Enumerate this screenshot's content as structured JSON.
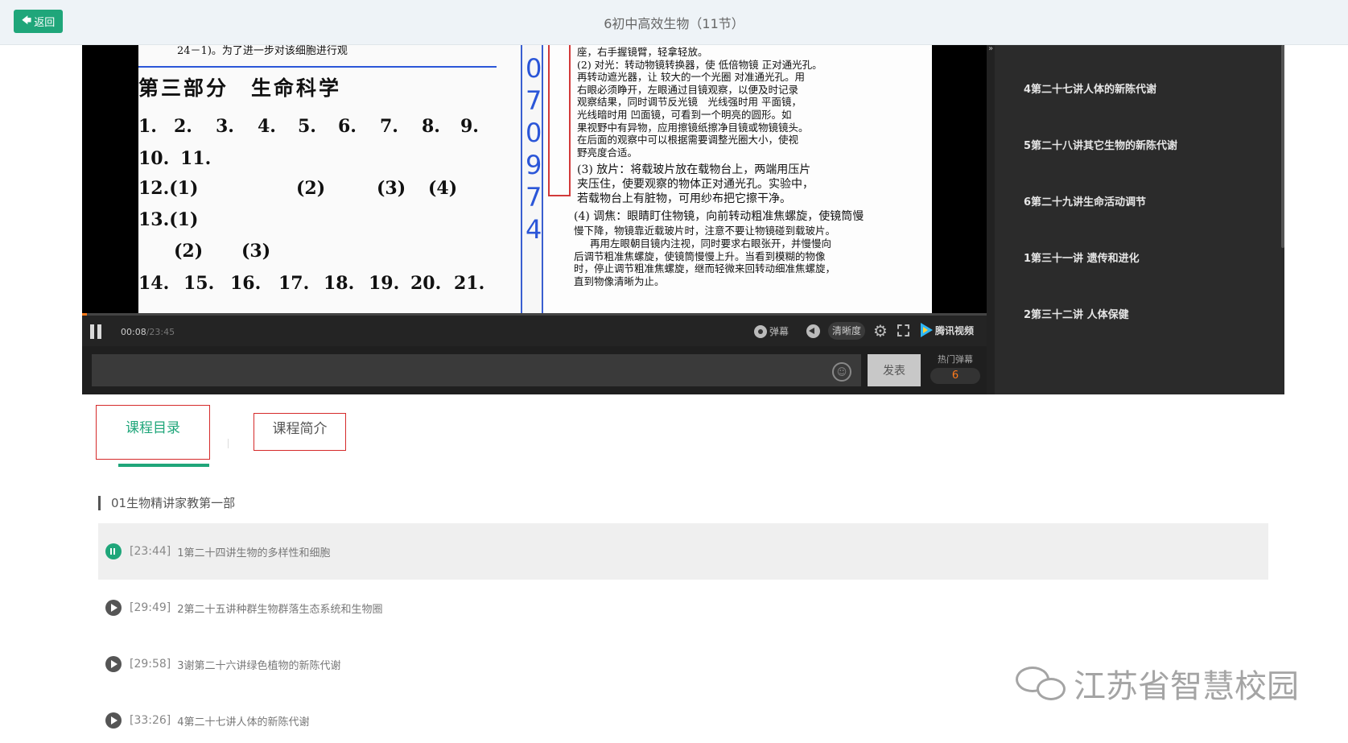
{
  "header": {
    "back_label": "返回",
    "title": "6初中高效生物（11节）"
  },
  "video": {
    "slide_left": {
      "top_line": "24－1)。为了进一步对该细胞进行观",
      "heading": "第三部分　生命科学",
      "rows": [
        [
          "1.",
          "2.",
          "3.",
          "4.",
          "5.",
          "6.",
          "7.",
          "8.",
          "9."
        ],
        [
          "10.",
          "11."
        ],
        [
          "12.(1)",
          "(2)",
          "(3)",
          "(4)"
        ],
        [
          "13.(1)"
        ],
        [
          "(2)",
          "(3)"
        ],
        [
          "14.",
          "15.",
          "16.",
          "17.",
          "18.",
          "19.",
          "20.",
          "21."
        ]
      ]
    },
    "slide_strip_digits": [
      "0",
      "7",
      "0",
      "9",
      "7",
      "4"
    ],
    "slide_right_lines": [
      "座，右手握镜臂，轻拿轻放。",
      "(2) 对光：转动物镜转换器，使 低倍物镜 正对通光孔。",
      "再转动遮光器，让 较大的一个光圈 对准通光孔。用",
      "右眼必须睁开，左眼通过目镜观察，以便及时记录",
      "观察结果，同时调节反光镜　光线强时用 平面镜，",
      "光线暗时用 凹面镜，可看到一个明亮的圆形。如",
      "果视野中有异物，应用擦镜纸擦净目镜或物镜镜头。",
      "在后面的观察中可以根据需要调整光圈大小，使视",
      "野亮度合适。",
      "(3) 放片：将载玻片放在载物台上，两端用压片",
      "夹压住，使要观察的物体正对通光孔。实验中，",
      "若载物台上有脏物，可用纱布把它擦干净。",
      "(4) 调焦：眼睛盯住物镜，向前转动粗准焦螺旋，使镜筒慢",
      "慢下降，物镜靠近载玻片时，注意不要让物镜碰到载玻片。",
      "再用左眼朝目镜内注视，同时要求右眼张开，并慢慢向",
      "后调节粗准焦螺旋，使镜筒慢慢上升。当看到模糊的物像",
      "时，停止调节粗准焦螺旋，继而轻微来回转动细准焦螺旋，",
      "直到物像清晰为止。"
    ],
    "progress_fraction": 0.0057
  },
  "controls": {
    "current_time": "00:08",
    "total_time": "/23:45",
    "danmu_label": "弹幕",
    "quality_label": "清晰度",
    "brand_label": "腾讯视频"
  },
  "danmu": {
    "input_placeholder": "",
    "send_label": "发表",
    "hot_label": "热门弹幕",
    "hot_icon": "6"
  },
  "sidebar": {
    "collapse_label": "»",
    "items": [
      {
        "label": "4第二十七讲人体的新陈代谢"
      },
      {
        "label": "5第二十八讲其它生物的新陈代谢"
      },
      {
        "label": "6第二十九讲生命活动调节"
      },
      {
        "label": "1第三十一讲 遗传和进化"
      },
      {
        "label": "2第三十二讲 人体保健"
      }
    ]
  },
  "tabs": {
    "catalog": "课程目录",
    "intro": "课程简介"
  },
  "section": {
    "title": "01生物精讲家教第一部"
  },
  "lessons": [
    {
      "duration": "[23:44]",
      "name": "1第二十四讲生物的多样性和细胞",
      "active": true
    },
    {
      "duration": "[29:49]",
      "name": "2第二十五讲种群生物群落生态系统和生物圈",
      "active": false
    },
    {
      "duration": "[29:58]",
      "name": "3谢第二十六讲绿色植物的新陈代谢",
      "active": false
    },
    {
      "duration": "[33:26]",
      "name": "4第二十七讲人体的新陈代谢",
      "active": false
    }
  ],
  "watermark": {
    "text": "江苏省智慧校园"
  },
  "colors": {
    "accent": "#1fa67a",
    "highlight_border": "#d52a2a",
    "progress": "#ff7a1a"
  }
}
